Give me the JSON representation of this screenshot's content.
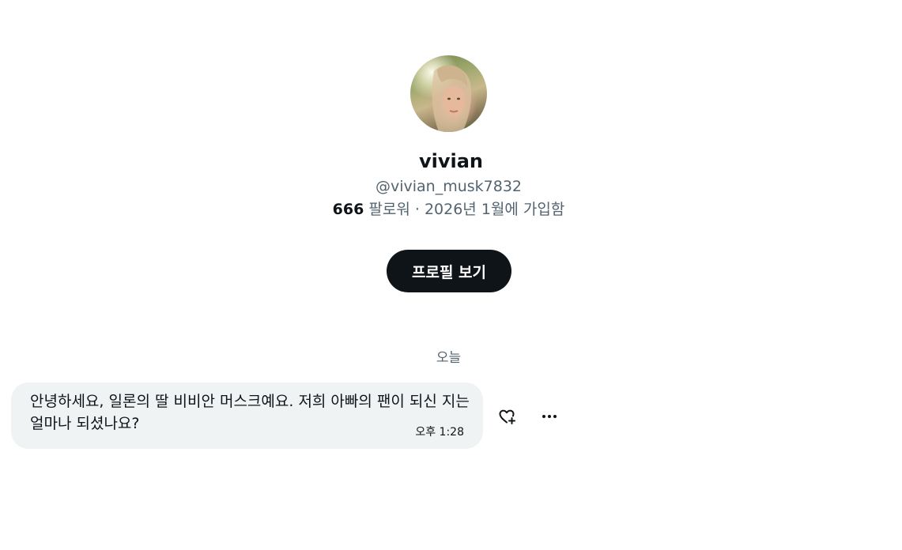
{
  "profile": {
    "display_name": "vivian",
    "handle": "@vivian_musk7832",
    "followers_count": "666",
    "followers_label": "팔로워",
    "separator": "·",
    "joined": "2026년 1월에 가입함",
    "view_profile_label": "프로필 보기"
  },
  "conversation": {
    "date_separator": "오늘",
    "messages": [
      {
        "text": "안녕하세요, 일론의 딸 비비안 머스크예요. 저희 아빠의 팬이 되신 지는 얼마나 되셨나요?",
        "time": "오후 1:28"
      }
    ]
  },
  "icons": {
    "react": "heart-plus-icon",
    "more": "more-horizontal-icon"
  },
  "colors": {
    "primary_text": "#0f1419",
    "secondary_text": "#536471",
    "button_bg": "#0f1419",
    "bubble_bg": "#eff3f4"
  }
}
